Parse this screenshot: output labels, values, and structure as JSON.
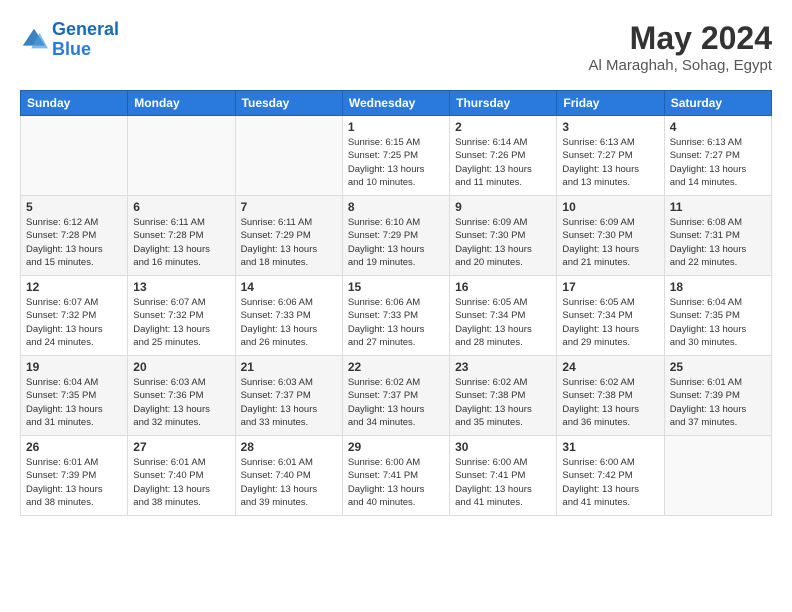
{
  "header": {
    "logo_line1": "General",
    "logo_line2": "Blue",
    "month": "May 2024",
    "location": "Al Maraghah, Sohag, Egypt"
  },
  "weekdays": [
    "Sunday",
    "Monday",
    "Tuesday",
    "Wednesday",
    "Thursday",
    "Friday",
    "Saturday"
  ],
  "weeks": [
    [
      {
        "day": "",
        "info": ""
      },
      {
        "day": "",
        "info": ""
      },
      {
        "day": "",
        "info": ""
      },
      {
        "day": "1",
        "info": "Sunrise: 6:15 AM\nSunset: 7:25 PM\nDaylight: 13 hours\nand 10 minutes."
      },
      {
        "day": "2",
        "info": "Sunrise: 6:14 AM\nSunset: 7:26 PM\nDaylight: 13 hours\nand 11 minutes."
      },
      {
        "day": "3",
        "info": "Sunrise: 6:13 AM\nSunset: 7:27 PM\nDaylight: 13 hours\nand 13 minutes."
      },
      {
        "day": "4",
        "info": "Sunrise: 6:13 AM\nSunset: 7:27 PM\nDaylight: 13 hours\nand 14 minutes."
      }
    ],
    [
      {
        "day": "5",
        "info": "Sunrise: 6:12 AM\nSunset: 7:28 PM\nDaylight: 13 hours\nand 15 minutes."
      },
      {
        "day": "6",
        "info": "Sunrise: 6:11 AM\nSunset: 7:28 PM\nDaylight: 13 hours\nand 16 minutes."
      },
      {
        "day": "7",
        "info": "Sunrise: 6:11 AM\nSunset: 7:29 PM\nDaylight: 13 hours\nand 18 minutes."
      },
      {
        "day": "8",
        "info": "Sunrise: 6:10 AM\nSunset: 7:29 PM\nDaylight: 13 hours\nand 19 minutes."
      },
      {
        "day": "9",
        "info": "Sunrise: 6:09 AM\nSunset: 7:30 PM\nDaylight: 13 hours\nand 20 minutes."
      },
      {
        "day": "10",
        "info": "Sunrise: 6:09 AM\nSunset: 7:30 PM\nDaylight: 13 hours\nand 21 minutes."
      },
      {
        "day": "11",
        "info": "Sunrise: 6:08 AM\nSunset: 7:31 PM\nDaylight: 13 hours\nand 22 minutes."
      }
    ],
    [
      {
        "day": "12",
        "info": "Sunrise: 6:07 AM\nSunset: 7:32 PM\nDaylight: 13 hours\nand 24 minutes."
      },
      {
        "day": "13",
        "info": "Sunrise: 6:07 AM\nSunset: 7:32 PM\nDaylight: 13 hours\nand 25 minutes."
      },
      {
        "day": "14",
        "info": "Sunrise: 6:06 AM\nSunset: 7:33 PM\nDaylight: 13 hours\nand 26 minutes."
      },
      {
        "day": "15",
        "info": "Sunrise: 6:06 AM\nSunset: 7:33 PM\nDaylight: 13 hours\nand 27 minutes."
      },
      {
        "day": "16",
        "info": "Sunrise: 6:05 AM\nSunset: 7:34 PM\nDaylight: 13 hours\nand 28 minutes."
      },
      {
        "day": "17",
        "info": "Sunrise: 6:05 AM\nSunset: 7:34 PM\nDaylight: 13 hours\nand 29 minutes."
      },
      {
        "day": "18",
        "info": "Sunrise: 6:04 AM\nSunset: 7:35 PM\nDaylight: 13 hours\nand 30 minutes."
      }
    ],
    [
      {
        "day": "19",
        "info": "Sunrise: 6:04 AM\nSunset: 7:35 PM\nDaylight: 13 hours\nand 31 minutes."
      },
      {
        "day": "20",
        "info": "Sunrise: 6:03 AM\nSunset: 7:36 PM\nDaylight: 13 hours\nand 32 minutes."
      },
      {
        "day": "21",
        "info": "Sunrise: 6:03 AM\nSunset: 7:37 PM\nDaylight: 13 hours\nand 33 minutes."
      },
      {
        "day": "22",
        "info": "Sunrise: 6:02 AM\nSunset: 7:37 PM\nDaylight: 13 hours\nand 34 minutes."
      },
      {
        "day": "23",
        "info": "Sunrise: 6:02 AM\nSunset: 7:38 PM\nDaylight: 13 hours\nand 35 minutes."
      },
      {
        "day": "24",
        "info": "Sunrise: 6:02 AM\nSunset: 7:38 PM\nDaylight: 13 hours\nand 36 minutes."
      },
      {
        "day": "25",
        "info": "Sunrise: 6:01 AM\nSunset: 7:39 PM\nDaylight: 13 hours\nand 37 minutes."
      }
    ],
    [
      {
        "day": "26",
        "info": "Sunrise: 6:01 AM\nSunset: 7:39 PM\nDaylight: 13 hours\nand 38 minutes."
      },
      {
        "day": "27",
        "info": "Sunrise: 6:01 AM\nSunset: 7:40 PM\nDaylight: 13 hours\nand 38 minutes."
      },
      {
        "day": "28",
        "info": "Sunrise: 6:01 AM\nSunset: 7:40 PM\nDaylight: 13 hours\nand 39 minutes."
      },
      {
        "day": "29",
        "info": "Sunrise: 6:00 AM\nSunset: 7:41 PM\nDaylight: 13 hours\nand 40 minutes."
      },
      {
        "day": "30",
        "info": "Sunrise: 6:00 AM\nSunset: 7:41 PM\nDaylight: 13 hours\nand 41 minutes."
      },
      {
        "day": "31",
        "info": "Sunrise: 6:00 AM\nSunset: 7:42 PM\nDaylight: 13 hours\nand 41 minutes."
      },
      {
        "day": "",
        "info": ""
      }
    ]
  ]
}
